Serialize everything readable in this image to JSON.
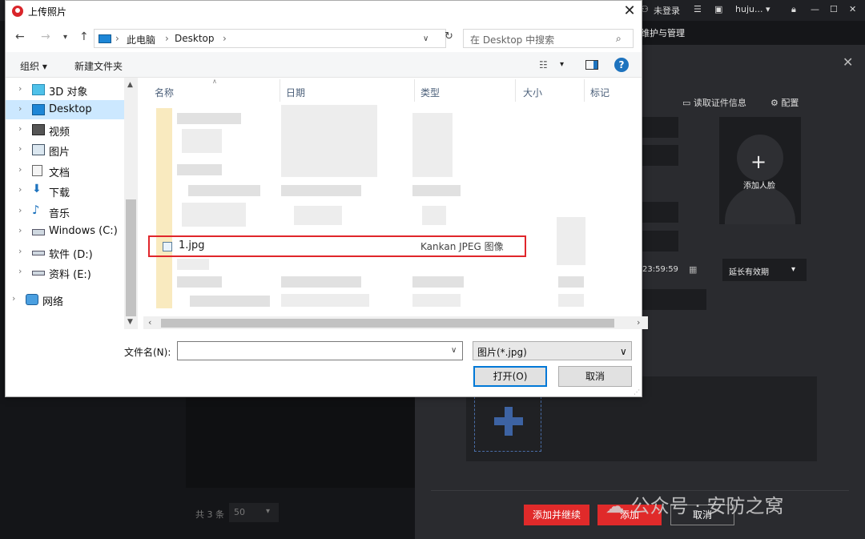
{
  "background_app": {
    "status_not_logged_in": "未登录",
    "user": "huju...",
    "menu_text": "维护与管理",
    "read_id_info": "读取证件信息",
    "config": "配置",
    "add_face": "添加人脸",
    "time_value": "23:59:59",
    "validity": "延长有效期",
    "list_total": "共 3 条",
    "page_size": "50",
    "add_continue": "添加并继续",
    "add": "添加",
    "cancel": "取消",
    "watermark": "公众号 · 安防之窝"
  },
  "dialog": {
    "title": "上传照片",
    "address": {
      "root": "此电脑",
      "folder": "Desktop"
    },
    "search_placeholder": "在 Desktop 中搜索",
    "toolbar": {
      "organize": "组织 ▾",
      "new_folder": "新建文件夹"
    },
    "sidebar": [
      {
        "label": "3D 对象",
        "icon": "3d-objects-icon"
      },
      {
        "label": "Desktop",
        "icon": "desktop-icon",
        "selected": true
      },
      {
        "label": "视频",
        "icon": "video-icon"
      },
      {
        "label": "图片",
        "icon": "pictures-icon"
      },
      {
        "label": "文档",
        "icon": "documents-icon"
      },
      {
        "label": "下载",
        "icon": "download-icon"
      },
      {
        "label": "音乐",
        "icon": "music-icon"
      },
      {
        "label": "Windows (C:)",
        "icon": "drive-icon"
      },
      {
        "label": "软件 (D:)",
        "icon": "drive-icon"
      },
      {
        "label": "资料 (E:)",
        "icon": "drive-icon"
      },
      {
        "label": "网络",
        "icon": "network-icon"
      }
    ],
    "columns": {
      "name": "名称",
      "date": "日期",
      "type": "类型",
      "size": "大小",
      "tag": "标记"
    },
    "highlighted_file": {
      "name": "1.jpg",
      "type": "Kankan JPEG 图像"
    },
    "filename_label": "文件名(N):",
    "filename_value": "",
    "filetype": "图片(*.jpg)",
    "open_button": "打开(O)",
    "cancel_button": "取消"
  },
  "colors": {
    "accent_red": "#e02a2a",
    "selection_blue": "#cce8ff",
    "focus_blue": "#0078d7"
  }
}
